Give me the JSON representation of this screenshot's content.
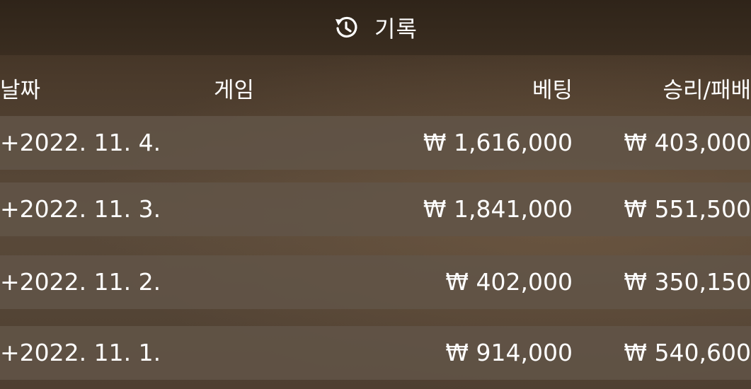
{
  "header": {
    "title": "기록",
    "icon": "history-icon"
  },
  "columns": {
    "date": "날짜",
    "game": "게임",
    "bet": "베팅",
    "result": "승리/패배"
  },
  "rows": [
    {
      "date": "+2022. 11. 4.",
      "bet": "₩ 1,616,000",
      "result": "₩ 403,000"
    },
    {
      "date": "+2022. 11. 3.",
      "bet": "₩ 1,841,000",
      "result": "₩ 551,500"
    },
    {
      "date": "+2022. 11. 2.",
      "bet": "₩ 402,000",
      "result": "₩ 350,150"
    },
    {
      "date": "+2022. 11. 1.",
      "bet": "₩ 914,000",
      "result": "₩ 540,600"
    }
  ],
  "colors": {
    "header_bg": "#2f2419",
    "row_bg": "#625548",
    "text": "#ffffff"
  }
}
